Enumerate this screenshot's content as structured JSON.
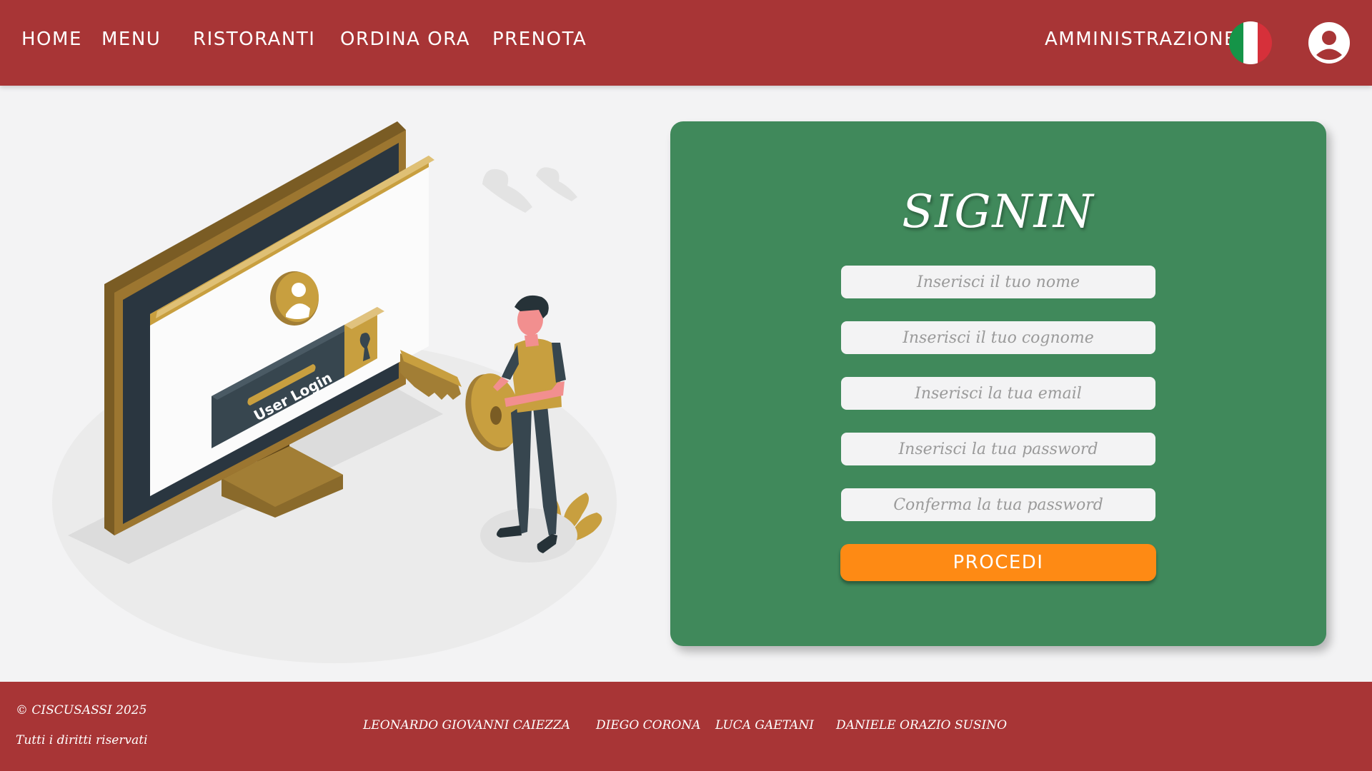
{
  "nav": {
    "home": "HOME",
    "menu": "MENU",
    "ristoranti": "RISTORANTI",
    "ordina": "ORDINA ORA",
    "prenota": "PRENOTA",
    "admin": "AMMINISTRAZIONE",
    "flag_icon": "italy-flag-icon",
    "user_icon": "user-account-icon"
  },
  "illustration": {
    "screen_button_text": "User Login"
  },
  "form": {
    "title": "SIGNIN",
    "nome_placeholder": "Inserisci il tuo nome",
    "cognome_placeholder": "Inserisci il tuo cognome",
    "email_placeholder": "Inserisci la tua email",
    "password_placeholder": "Inserisci la tua password",
    "confirm_placeholder": "Conferma la tua password",
    "submit_label": "PROCEDI"
  },
  "footer": {
    "copyright": "© CISCUSASSI 2025",
    "rights": "Tutti i diritti riservati",
    "authors": [
      "LEONARDO GIOVANNI CAIEZZA",
      "DIEGO CORONA",
      "LUCA GAETANI",
      "DANIELE ORAZIO SUSINO"
    ]
  },
  "colors": {
    "brand_red": "#a83536",
    "card_green": "#40895b",
    "button_orange": "#fe8a14",
    "gold": "#c89f3f",
    "dark_slate": "#37464f"
  }
}
